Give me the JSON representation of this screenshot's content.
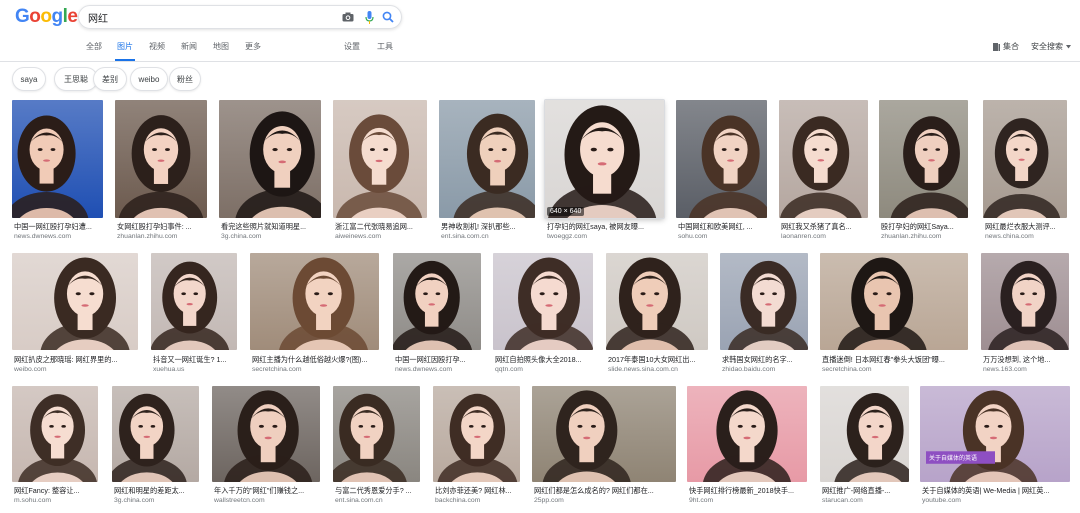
{
  "search": {
    "query": "网红"
  },
  "tabs": [
    {
      "label": "全部",
      "active": false
    },
    {
      "label": "图片",
      "active": true
    },
    {
      "label": "视频",
      "active": false
    },
    {
      "label": "新闻",
      "active": false
    },
    {
      "label": "地图",
      "active": false
    },
    {
      "label": "更多",
      "active": false
    },
    {
      "label": "设置",
      "active": false
    },
    {
      "label": "工具",
      "active": false
    }
  ],
  "right_tools": {
    "collections": "集合",
    "safe_search": "安全搜索"
  },
  "chips": [
    {
      "label": "saya"
    },
    {
      "label": "王思聪"
    },
    {
      "label": "差别"
    },
    {
      "label": "weibo"
    },
    {
      "label": "粉丝"
    }
  ],
  "colors": {
    "accent": "#1a73e8",
    "caption": "#202124",
    "domain": "#70757a"
  },
  "rows": [
    {
      "tiles": [
        {
          "caption": "中国一网红殴打孕妇遭...",
          "domain": "news.dwnews.com",
          "bg": "#1f4fb3",
          "skin": "#f1cbb7",
          "hair": "#2b1d18"
        },
        {
          "caption": "女网红殴打孕妇事件: ...",
          "domain": "zhuanlan.zhihu.com",
          "bg": "#6c5a4e",
          "skin": "#f3d2c2",
          "hair": "#2c201b"
        },
        {
          "caption": "看完这些照片就知道明星...",
          "domain": "3g.china.com",
          "bg": "#7d6f66",
          "skin": "#f0d0bf",
          "hair": "#1d1614"
        },
        {
          "caption": "浙江富二代张晓易追网...",
          "domain": "aiweinews.com",
          "bg": "#c9b8ae",
          "skin": "#f5dccf",
          "hair": "#6a4b3a"
        },
        {
          "caption": "男神收割机! 深扒那些...",
          "domain": "ent.sina.com.cn",
          "bg": "#8a9aa8",
          "skin": "#efd0bc",
          "hair": "#3b2b22"
        },
        {
          "caption": "打孕妇的网红saya, 被网友曝...",
          "domain": "twoeggz.com",
          "bg": "#d9d6d4",
          "skin": "#f6dccf",
          "hair": "#241a16",
          "badge": "640 × 640",
          "selected": true
        },
        {
          "caption": "中国网红和欧美网红, ...",
          "domain": "sohu.com",
          "bg": "#5a5e66",
          "skin": "#f1d3c3",
          "hair": "#4a3326"
        },
        {
          "caption": "网红我又杀猪了真名...",
          "domain": "laonanren.com",
          "bg": "#b5a7a0",
          "skin": "#f5dccf",
          "hair": "#3a2a22"
        },
        {
          "caption": "殴打孕妇的网红Saya...",
          "domain": "zhuanlan.zhihu.com",
          "bg": "#8e8a7e",
          "skin": "#efcfbf",
          "hair": "#2a1e1a"
        },
        {
          "caption": "网红最烂衣服大测评...",
          "domain": "news.china.com",
          "bg": "#a69a90",
          "skin": "#f3d6c8",
          "hair": "#2f2420"
        }
      ]
    },
    {
      "tiles": [
        {
          "caption": "网红扒皮之那晓瑶: 网红界里的...",
          "domain": "weibo.com",
          "bg": "#d8ccc6",
          "skin": "#f6ddd0",
          "hair": "#3a2a22"
        },
        {
          "caption": "抖音又一网红诞生? 1...",
          "domain": "xuehua.us",
          "bg": "#c2b8b4",
          "skin": "#f3d7cb",
          "hair": "#35261f"
        },
        {
          "caption": "网红主播为什么越低俗越火爆?(图)...",
          "domain": "secretchina.com",
          "bg": "#a08c7a",
          "skin": "#f2d3c1",
          "hair": "#6c4a34"
        },
        {
          "caption": "中国一网红因殴打孕...",
          "domain": "news.dwnews.com",
          "bg": "#8f8c88",
          "skin": "#f1d1c1",
          "hair": "#231a16"
        },
        {
          "caption": "网红自拍照头像大全2018...",
          "domain": "qqtn.com",
          "bg": "#c9c3cc",
          "skin": "#f5dad0",
          "hair": "#3e2d26"
        },
        {
          "caption": "2017年泰国10大女网红出...",
          "domain": "slide.news.sina.com.cn",
          "bg": "#cfc9c3",
          "skin": "#efcdb9",
          "hair": "#2f221c"
        },
        {
          "caption": "求韩国女网红的名字...",
          "domain": "zhidao.baidu.com",
          "bg": "#9aa3b3",
          "skin": "#f3dbd2",
          "hair": "#3a2b25"
        },
        {
          "caption": "直播迷倒! 日本网红春\"拳头大饭团\"曝...",
          "domain": "secretchina.com",
          "bg": "#b9a695",
          "skin": "#e9c5b0",
          "hair": "#1e1714"
        },
        {
          "caption": "万万没想到, 这个地...",
          "domain": "news.163.com",
          "bg": "#9e8e92",
          "skin": "#f1d3c6",
          "hair": "#2a2020"
        }
      ]
    },
    {
      "tiles": [
        {
          "caption": "网红Fancy: 整容让...",
          "domain": "m.sohu.com",
          "bg": "#c6b7b0",
          "skin": "#f6ddd1",
          "hair": "#3e2e26"
        },
        {
          "caption": "网红和明星的差距太...",
          "domain": "3g.china.com",
          "bg": "#b4a9a3",
          "skin": "#f2d4c5",
          "hair": "#2e221d"
        },
        {
          "caption": "年入千万的\"网红\"们赚钱之...",
          "domain": "wallstreetcn.com",
          "bg": "#6d6560",
          "skin": "#efcfbf",
          "hair": "#2a1f1a"
        },
        {
          "caption": "与富二代秀恩爱分手? ...",
          "domain": "ent.sina.com.cn",
          "bg": "#8a8680",
          "skin": "#f1d2c2",
          "hair": "#3a2b22"
        },
        {
          "caption": "比刘亦菲还美? 网红林...",
          "domain": "backchina.com",
          "bg": "#b8a99e",
          "skin": "#f3d6c7",
          "hair": "#3f2d24"
        },
        {
          "caption": "网红们都是怎么成名的? 网红们都在...",
          "domain": "25pp.com",
          "bg": "#8f8474",
          "skin": "#f0d0bf",
          "hair": "#2f241e"
        },
        {
          "caption": "快手网红排行榜最新_2018快手...",
          "domain": "9ht.com",
          "bg": "#e79aa6",
          "skin": "#f4d8cb",
          "hair": "#2a1f1b"
        },
        {
          "caption": "网红推广-网络直播-...",
          "domain": "starucan.com",
          "bg": "#d9d5d2",
          "skin": "#f3d6c9",
          "hair": "#2c211c"
        },
        {
          "caption": "关于自媒体的英语| We-Media | 网红英...",
          "domain": "youtube.com",
          "bg": "#b7a3c9",
          "skin": "#f2d3c4",
          "hair": "#4a3326",
          "overlay": "关于自媒体的英语"
        }
      ]
    }
  ]
}
